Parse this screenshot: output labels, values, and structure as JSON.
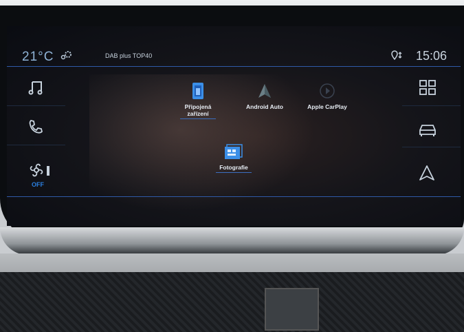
{
  "status_bar": {
    "temperature": "21°C",
    "radio_station": "DAB plus TOP40",
    "time": "15:06",
    "settings_icon": "gear-icon",
    "gps_icon": "location-pin-icon"
  },
  "left_menu": {
    "items": [
      {
        "name": "music",
        "icon": "music-note-icon"
      },
      {
        "name": "phone",
        "icon": "phone-icon"
      },
      {
        "name": "climate",
        "icon": "fan-icon",
        "label": "OFF"
      }
    ]
  },
  "right_menu": {
    "items": [
      {
        "name": "apps",
        "icon": "grid-icon"
      },
      {
        "name": "vehicle",
        "icon": "car-icon"
      },
      {
        "name": "navigation",
        "icon": "navigation-arrow-icon"
      }
    ]
  },
  "apps": [
    {
      "label_line1": "Připojená",
      "label_line2": "zařízení",
      "icon": "connected-devices-icon"
    },
    {
      "label_line1": "Android Auto",
      "label_line2": "",
      "icon": "android-auto-icon"
    },
    {
      "label_line1": "Apple CarPlay",
      "label_line2": "",
      "icon": "carplay-icon"
    },
    {
      "label_line1": "Fotografie",
      "label_line2": "",
      "icon": "photos-icon"
    }
  ],
  "colors": {
    "accent": "#2a7fe0",
    "line": "#2f5aa8",
    "text": "#c8d3de"
  }
}
